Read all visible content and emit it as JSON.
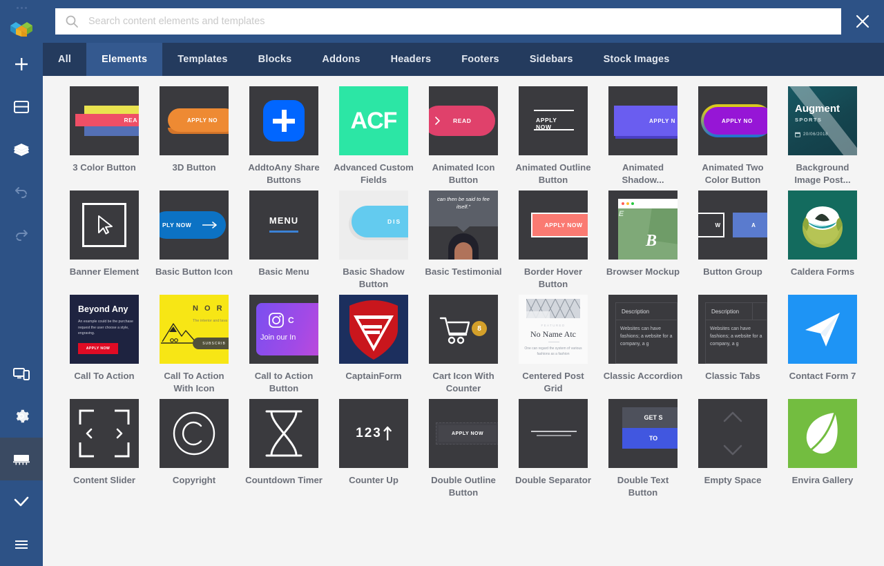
{
  "app": {
    "accent": "#2d5286",
    "tabs_bg": "#243b5e",
    "tab_active_bg": "#34598f",
    "content_bg": "#f4f4f4",
    "thumb_bg": "#3a3a3e",
    "label_color": "#6c707a"
  },
  "sidebar": {
    "items": [
      {
        "name": "logo",
        "icon": "cubes-logo-icon",
        "state": "static"
      },
      {
        "name": "add",
        "icon": "plus-icon",
        "state": "normal"
      },
      {
        "name": "layout",
        "icon": "layout-icon",
        "state": "normal"
      },
      {
        "name": "layers",
        "icon": "layers-icon",
        "state": "normal"
      },
      {
        "name": "undo",
        "icon": "undo-icon",
        "state": "dim"
      },
      {
        "name": "redo",
        "icon": "redo-icon",
        "state": "dim"
      },
      {
        "name": "responsive",
        "icon": "devices-icon",
        "state": "normal"
      },
      {
        "name": "settings",
        "icon": "gear-icon",
        "state": "normal"
      },
      {
        "name": "library",
        "icon": "library-icon",
        "state": "active"
      },
      {
        "name": "publish",
        "icon": "check-icon",
        "state": "normal"
      },
      {
        "name": "menu",
        "icon": "hamburger-icon",
        "state": "normal"
      }
    ]
  },
  "search": {
    "placeholder": "Search content elements and templates",
    "value": "",
    "icon": "search-icon"
  },
  "close": {
    "label": "×",
    "icon": "close-icon"
  },
  "tabs": [
    {
      "label": "All",
      "active": false
    },
    {
      "label": "Elements",
      "active": true
    },
    {
      "label": "Templates",
      "active": false
    },
    {
      "label": "Blocks",
      "active": false
    },
    {
      "label": "Addons",
      "active": false
    },
    {
      "label": "Headers",
      "active": false
    },
    {
      "label": "Footers",
      "active": false
    },
    {
      "label": "Sidebars",
      "active": false
    },
    {
      "label": "Stock Images",
      "active": false
    }
  ],
  "elements": [
    {
      "label": "3 Color Button",
      "art": "three-color",
      "text": "REA"
    },
    {
      "label": "3D Button",
      "art": "three-d",
      "text": "APPLY NO"
    },
    {
      "label": "AddtoAny Share Buttons",
      "art": "addtoany",
      "text": ""
    },
    {
      "label": "Advanced Custom Fields",
      "art": "acf",
      "text": "ACF"
    },
    {
      "label": "Animated Icon Button",
      "art": "animated-icon",
      "text": "READ"
    },
    {
      "label": "Animated Outline Button",
      "art": "animated-outline",
      "text": "APPLY NOW"
    },
    {
      "label": "Animated Shadow...",
      "art": "animated-shadow",
      "text": "APPLY N"
    },
    {
      "label": "Animated Two Color Button",
      "art": "animated-two",
      "text": "APPLY NO"
    },
    {
      "label": "Background Image Post...",
      "art": "bg-image-post",
      "text": "Augment",
      "sub": "SPORTS",
      "meta": "20/06/2018"
    },
    {
      "label": "Banner Element",
      "art": "banner",
      "text": ""
    },
    {
      "label": "Basic Button Icon",
      "art": "basic-btn-icon",
      "text": "PLY NOW"
    },
    {
      "label": "Basic Menu",
      "art": "basic-menu",
      "text": "MENU"
    },
    {
      "label": "Basic Shadow Button",
      "art": "basic-shadow",
      "text": "DIS"
    },
    {
      "label": "Basic Testimonial",
      "art": "testimonial",
      "text": "can then be said to fee itself.\""
    },
    {
      "label": "Border Hover Button",
      "art": "border-hover",
      "text": "APPLY NOW"
    },
    {
      "label": "Browser Mockup",
      "art": "browser-mockup",
      "text": "B"
    },
    {
      "label": "Button Group",
      "art": "button-group",
      "text": "W",
      "text2": "A"
    },
    {
      "label": "Caldera Forms",
      "art": "caldera",
      "text": ""
    },
    {
      "label": "Call To Action",
      "art": "cta",
      "text": "Beyond Any",
      "body": "An example could be the purchase request the user choose a style, engraving.",
      "btn": "APPLY NOW"
    },
    {
      "label": "Call To Action With Icon",
      "art": "cta-icon",
      "text": "N O R",
      "body": "The interior and lava field",
      "btn": "SUBSCRIB"
    },
    {
      "label": "Call to Action Button",
      "art": "cta-button",
      "text": "Join our In"
    },
    {
      "label": "CaptainForm",
      "art": "captainform",
      "text": ""
    },
    {
      "label": "Cart Icon With Counter",
      "art": "cart-counter",
      "text": "8"
    },
    {
      "label": "Centered Post Grid",
      "art": "post-grid",
      "text": "No Name Atc",
      "sub": "FEATURED",
      "body": "One can regard the system of various fashions as a fashion"
    },
    {
      "label": "Classic Accordion",
      "art": "accordion",
      "text": "Description",
      "body": "Websites can have fashions; a website for a company, a g"
    },
    {
      "label": "Classic Tabs",
      "art": "tabs-art",
      "text": "Description",
      "body": "Websites can have fashions; a website for a company, a g"
    },
    {
      "label": "Contact Form 7",
      "art": "cf7",
      "text": ""
    },
    {
      "label": "Content Slider",
      "art": "content-slider",
      "text": ""
    },
    {
      "label": "Copyright",
      "art": "copyright",
      "text": ""
    },
    {
      "label": "Countdown Timer",
      "art": "countdown",
      "text": ""
    },
    {
      "label": "Counter Up",
      "art": "counter-up",
      "text": "123"
    },
    {
      "label": "Double Outline Button",
      "art": "double-outline",
      "text": "APPLY NOW"
    },
    {
      "label": "Double Separator",
      "art": "double-separator",
      "text": ""
    },
    {
      "label": "Double Text Button",
      "art": "double-text",
      "text": "GET S",
      "text2": "TO"
    },
    {
      "label": "Empty Space",
      "art": "empty-space",
      "text": ""
    },
    {
      "label": "Envira Gallery",
      "art": "envira",
      "text": ""
    }
  ]
}
